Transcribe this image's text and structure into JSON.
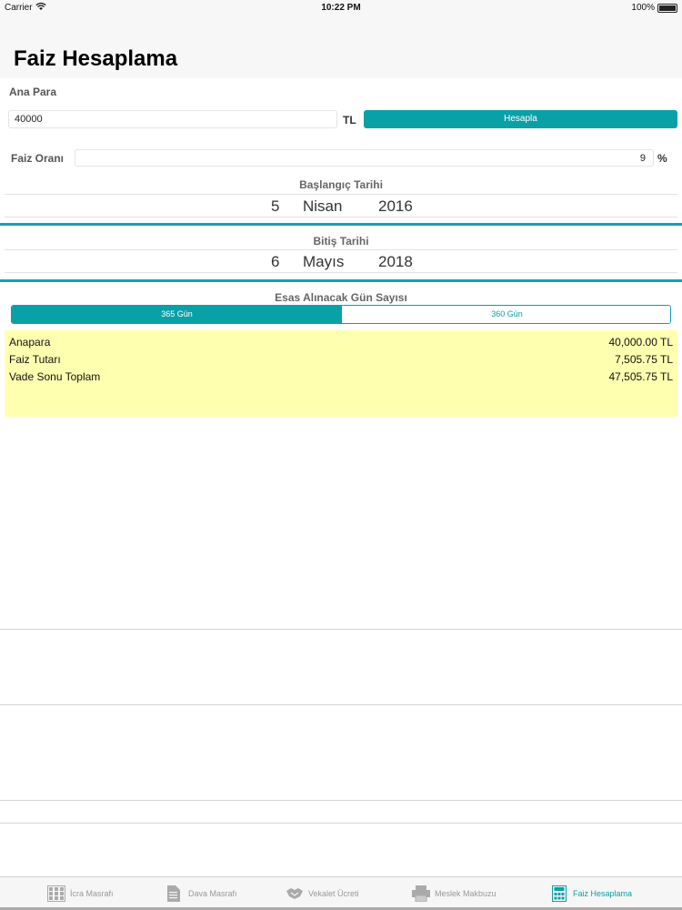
{
  "status_bar": {
    "carrier": "Carrier",
    "time": "10:22 PM",
    "battery": "100%"
  },
  "header": {
    "title": "Faiz Hesaplama"
  },
  "form": {
    "principal_label": "Ana Para",
    "principal_value": "40000",
    "currency_unit": "TL",
    "calculate_button": "Hesapla",
    "rate_label": "Faiz Oranı",
    "rate_value": "9",
    "rate_unit": "%"
  },
  "start_date": {
    "title": "Başlangıç Tarihi",
    "day": "5",
    "month": "Nisan",
    "year": "2016"
  },
  "end_date": {
    "title": "Bitiş Tarihi",
    "day": "6",
    "month": "Mayıs",
    "year": "2018"
  },
  "day_basis": {
    "title": "Esas Alınacak Gün Sayısı",
    "options": [
      "365 Gün",
      "360 Gün"
    ],
    "selected": "365 Gün"
  },
  "results": [
    {
      "label": "Anapara",
      "value": "40,000.00 TL"
    },
    {
      "label": "Faiz Tutarı",
      "value": "7,505.75 TL"
    },
    {
      "label": "Vade Sonu Toplam",
      "value": "47,505.75 TL"
    }
  ],
  "tabs": [
    {
      "label": "İcra Masrafı",
      "icon": "calculator-grid-icon",
      "active": false
    },
    {
      "label": "Dava Masrafı",
      "icon": "document-icon",
      "active": false
    },
    {
      "label": "Vekalet Ücreti",
      "icon": "handshake-icon",
      "active": false
    },
    {
      "label": "Meslek Makbuzu",
      "icon": "printer-icon",
      "active": false
    },
    {
      "label": "Faiz Hesaplama",
      "icon": "calculator-icon",
      "active": true
    }
  ],
  "colors": {
    "accent": "#0aa0a8",
    "results_background": "#ffffb0"
  }
}
